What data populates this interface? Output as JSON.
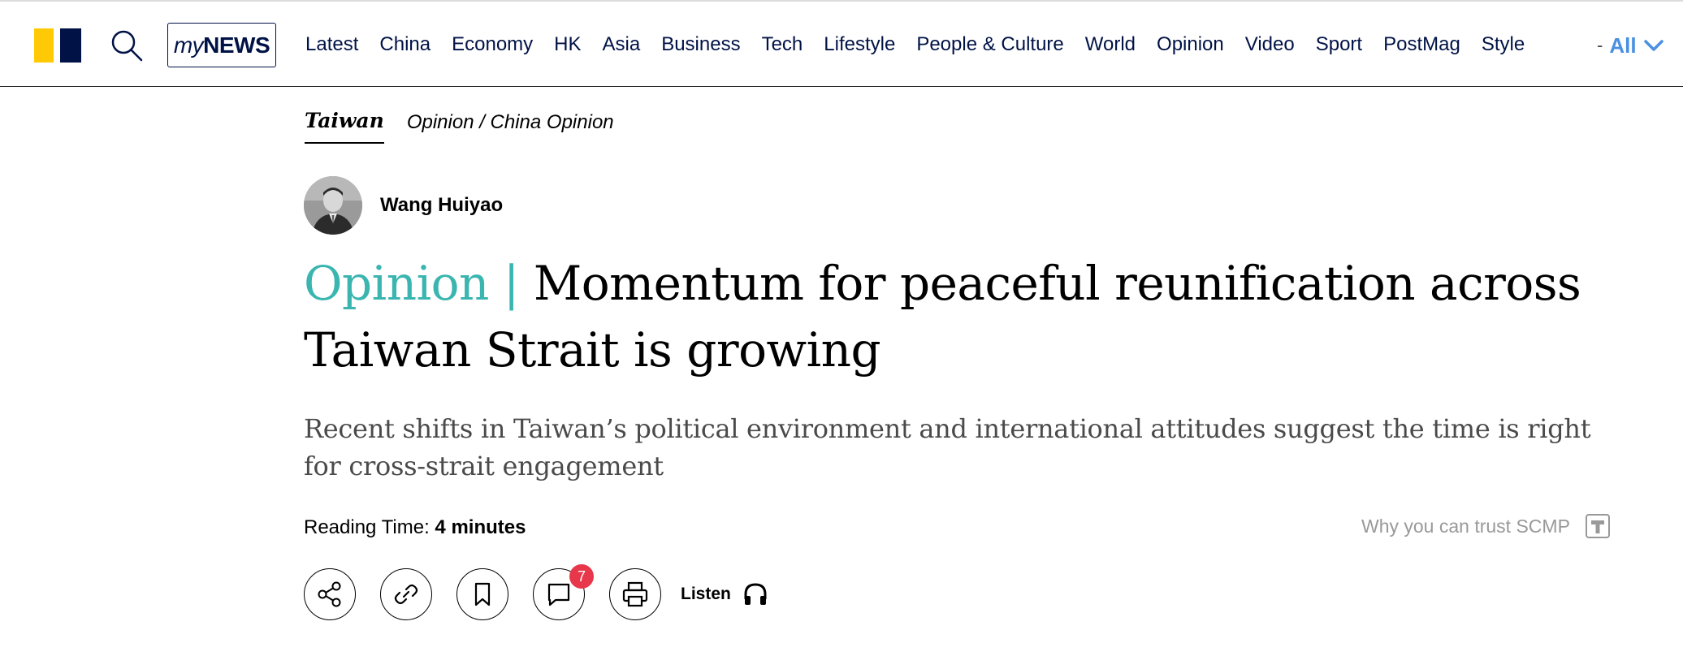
{
  "brand": {
    "logo_colors": {
      "yellow": "#FFCA05",
      "navy": "#001246"
    }
  },
  "header": {
    "mynews": {
      "my": "my",
      "news": "NEWS"
    },
    "nav_items": [
      "Latest",
      "China",
      "Economy",
      "HK",
      "Asia",
      "Business",
      "Tech",
      "Lifestyle",
      "People & Culture",
      "World",
      "Opinion",
      "Video",
      "Sport",
      "PostMag",
      "Style"
    ],
    "all_dash": "-",
    "all_label": "All",
    "icons": {
      "search": "search-icon",
      "all_chevron": "chevron-down-icon"
    }
  },
  "article": {
    "tags": {
      "primary": "Taiwan",
      "secondary": "Opinion / China Opinion"
    },
    "author": {
      "name": "Wang Huiyao"
    },
    "headline": {
      "label": "Opinion",
      "separator": "|",
      "text": "Momentum for peaceful reunification across Taiwan Strait is growing"
    },
    "subheadline": "Recent shifts in Taiwan’s political environment and international attitudes suggest the time is right for cross-strait engagement",
    "reading_time": {
      "label": "Reading Time:",
      "value": "4 minutes"
    },
    "trust": {
      "text": "Why you can trust SCMP"
    },
    "actions": {
      "share": "share-icon",
      "copy_link": "link-icon",
      "bookmark": "bookmark-icon",
      "comments": "comment-icon",
      "comment_count": "7",
      "print": "print-icon",
      "listen_label": "Listen"
    },
    "colors": {
      "opinion_accent": "#3AB5B0",
      "badge": "#E8364A",
      "link_blue": "#4A90E2"
    }
  }
}
